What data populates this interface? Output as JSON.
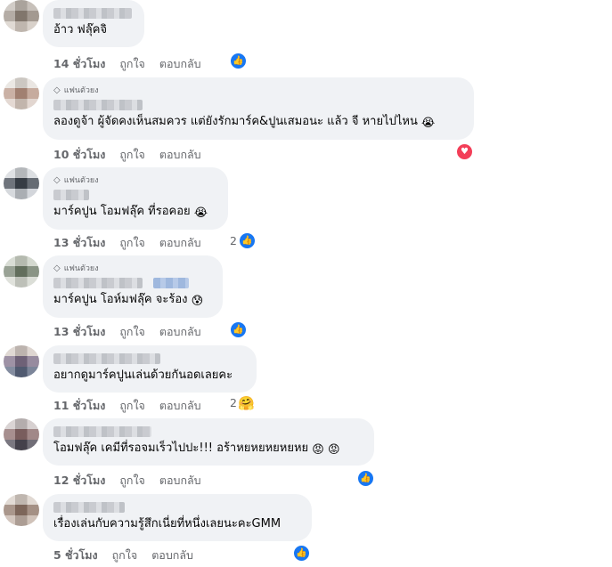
{
  "labels": {
    "like": "ถูกใจ",
    "reply": "ตอบกลับ",
    "fan_badge": "แฟนตัวยง"
  },
  "comments": [
    {
      "text": "อ้าว ฟลุ๊คจิ",
      "time": "14 ชั่วโมง",
      "reactions": {
        "icons": [
          "like-icon"
        ],
        "count": ""
      }
    },
    {
      "fan": true,
      "text": "ลองดูจ้า ผู้จัดคงเห็นสมควร แต่ยังรักมาร์ค&ปูนเสมอนะ แล้ว จี หายไปไหน",
      "emoji": "😭",
      "time": "10 ชั่วโมง",
      "reactions": {
        "icons": [
          "love-icon"
        ],
        "count": ""
      }
    },
    {
      "fan": true,
      "text": "มาร์คปูน โอมฟลุ๊ค ที่รอคอย",
      "emoji": "😭",
      "time": "13 ชั่วโมง",
      "reactions": {
        "icons": [
          "like-icon"
        ],
        "count": "2"
      }
    },
    {
      "fan": true,
      "text": "มาร์คปูน โอห์มฟลุ๊ค จะร้อง",
      "emoji": "😰",
      "time": "13 ชั่วโมง",
      "reactions": {
        "icons": [
          "like-icon"
        ],
        "count": ""
      }
    },
    {
      "text": "อยากดูมาร์คปูนเล่นด้วยกันอดเลยคะ",
      "time": "11 ชั่วโมง",
      "reactions": {
        "icons": [
          "care-icon"
        ],
        "count": "2"
      }
    },
    {
      "text": "โอมฟลุ๊ค เคมีที่รอจมเร็วไปปะ!!! อร้าหยหยหยหยหย",
      "emoji": "😡 😡",
      "time": "12 ชั่วโมง",
      "reactions": {
        "icons": [
          "like-icon"
        ],
        "count": ""
      }
    },
    {
      "text": "เรื่องเล่นกับความรู้สึกเนี่ยที่หนึ่งเลยนะคะGMM",
      "time": "5 ชั่วโมง",
      "reactions": {
        "icons": [
          "like-icon"
        ],
        "count": ""
      }
    }
  ],
  "colors": {
    "bubble": "#f0f2f5",
    "meta_text": "#65676b",
    "like": "#1877f2",
    "love": "#f33e58"
  }
}
